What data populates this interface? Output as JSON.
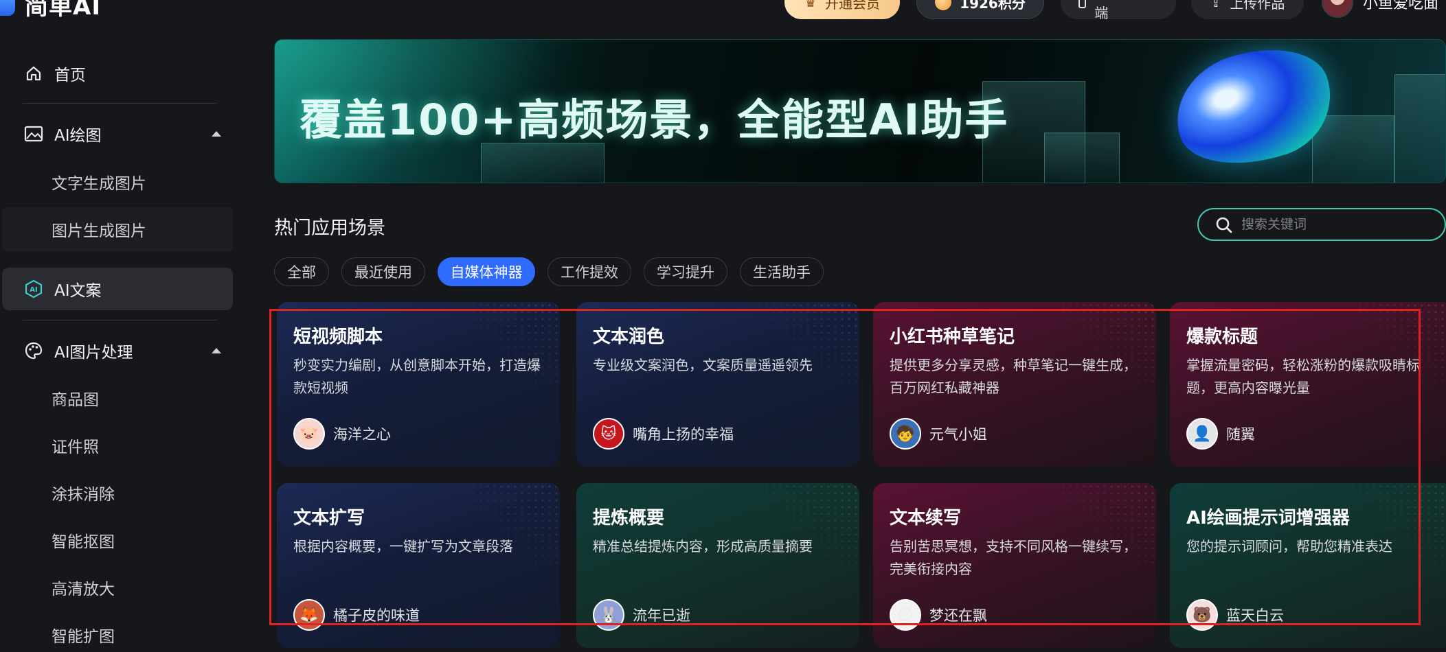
{
  "app": {
    "logo_text": "简单AI"
  },
  "topbar": {
    "vip_label": "开通会员",
    "points_label": "1926积分",
    "mobile_label": "体验移动端",
    "upload_label": "上传作品",
    "user_name": "小鱼爱吃面"
  },
  "sidebar": {
    "home": "首页",
    "ai_drawing": "AI绘图",
    "text_to_image": "文字生成图片",
    "image_to_image": "图片生成图片",
    "ai_copywriting": "AI文案",
    "ai_image_processing": "AI图片处理",
    "sub_items": [
      "商品图",
      "证件照",
      "涂抹消除",
      "智能抠图",
      "高清放大",
      "智能扩图"
    ]
  },
  "banner": {
    "title": "覆盖100+高频场景，全能型AI助手"
  },
  "main": {
    "section_title": "热门应用场景",
    "search_placeholder": "搜索关键词",
    "tabs": [
      "全部",
      "最近使用",
      "自媒体神器",
      "工作提效",
      "学习提升",
      "生活助手"
    ],
    "active_tab": "自媒体神器",
    "cards": [
      {
        "title": "短视频脚本",
        "desc": "秒变实力编剧，从创意脚本开始，打造爆款短视频",
        "author": "海洋之心",
        "theme": "blue"
      },
      {
        "title": "文本润色",
        "desc": "专业级文案润色，文案质量遥遥领先",
        "author": "嘴角上扬的幸福",
        "theme": "blue"
      },
      {
        "title": "小红书种草笔记",
        "desc": "提供更多分享灵感，种草笔记一键生成，百万网红私藏神器",
        "author": "元气小姐",
        "theme": "red"
      },
      {
        "title": "爆款标题",
        "desc": "掌握流量密码，轻松涨粉的爆款吸睛标题，更高内容曝光量",
        "author": "随翼",
        "theme": "red"
      },
      {
        "title": "文本扩写",
        "desc": "根据内容概要，一键扩写为文章段落",
        "author": "橘子皮的味道",
        "theme": "blue"
      },
      {
        "title": "提炼概要",
        "desc": "精准总结提炼内容，形成高质量摘要",
        "author": "流年已逝",
        "theme": "green"
      },
      {
        "title": "文本续写",
        "desc": "告别苦思冥想，支持不同风格一键续写，完美衔接内容",
        "author": "梦还在飘",
        "theme": "red"
      },
      {
        "title": "AI绘画提示词增强器",
        "desc": "您的提示词顾问，帮助您精准表达",
        "author": "蓝天白云",
        "theme": "green"
      }
    ]
  },
  "colors": {
    "accent": "#2f6bff",
    "search_border": "#3ec9b0",
    "highlight_box": "#e0231f"
  }
}
